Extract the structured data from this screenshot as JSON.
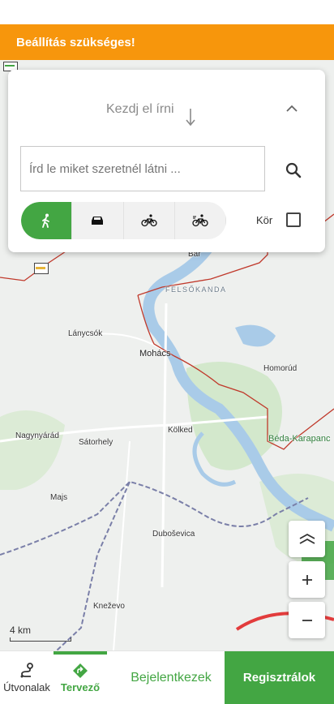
{
  "banner": {
    "text": "Beállítás szükséges!",
    "color": "#f7960c"
  },
  "planner": {
    "start_hint": "Kezdj el írni",
    "search_placeholder": "Írd le miket szeretnél látni ...",
    "modes": [
      "walk-icon",
      "car-icon",
      "bike-icon",
      "ebike-icon"
    ],
    "active_mode": "walk-icon",
    "round_trip_label": "Kör",
    "round_trip_checked": false
  },
  "map": {
    "places": {
      "bar": "Bár",
      "felsokanda": "FELSŐKANDA",
      "lanycsok": "Lánycsók",
      "mohacs": "Mohács",
      "homorud": "Homorúd",
      "beda": "Béda-Karapanc",
      "nagynyarad": "Nagynyárád",
      "satorhely": "Sátorhely",
      "kolked": "Kölked",
      "majs": "Majs",
      "dubosevica": "Duboševica",
      "knezevo": "Kneževo"
    },
    "scale_label": "4 km",
    "controls": [
      "layers-icon",
      "zoom-in-icon",
      "zoom-out-icon"
    ]
  },
  "bottom_nav": {
    "routes_label": "Útvonalak",
    "planner_label": "Tervező",
    "login_label": "Bejelentkezek",
    "register_label": "Regisztrálok"
  },
  "colors": {
    "accent": "#43a643",
    "warning": "#f7960c",
    "border": "#c0392b",
    "water": "#a9cbe8"
  }
}
